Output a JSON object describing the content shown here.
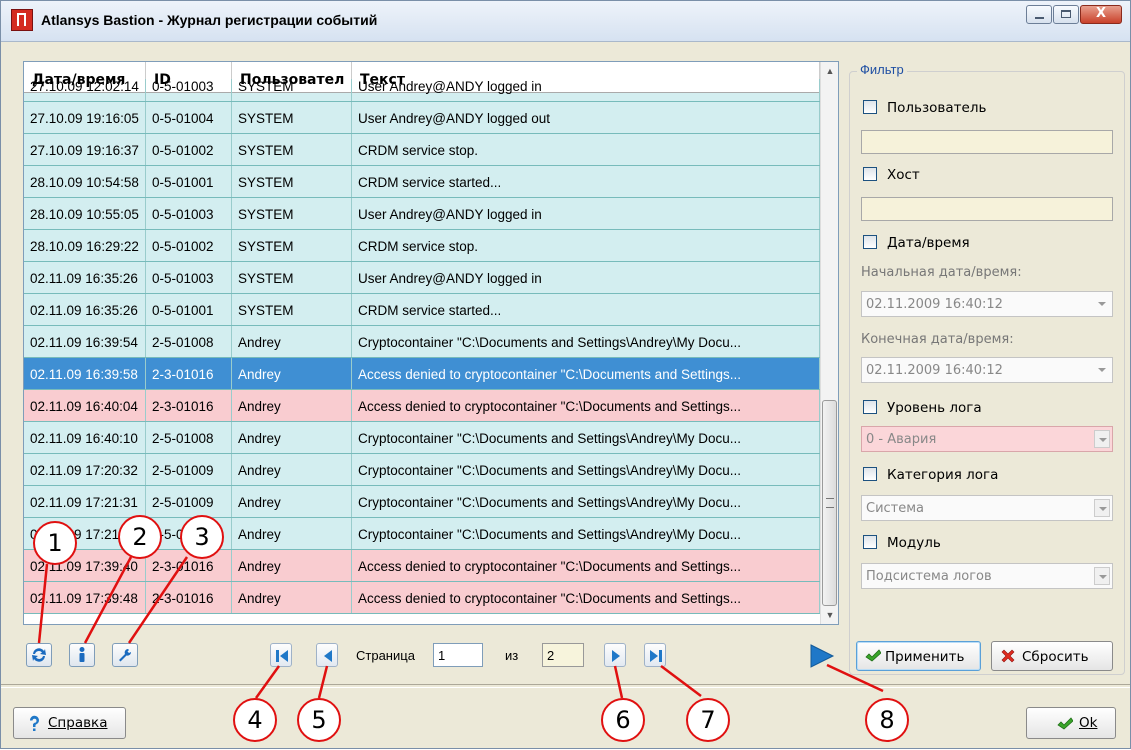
{
  "window": {
    "title": "Atlansys Bastion - Журнал регистрации событий",
    "close_glyph": "X"
  },
  "grid": {
    "columns": [
      "Дата/время",
      "ID",
      "Пользовател",
      "Текст"
    ],
    "partial_row": [
      "27.10.09 12:02:14",
      "0-5-01003",
      "SYSTEM",
      "User Andrey@ANDY logged in"
    ],
    "rows": [
      {
        "c": [
          "27.10.09 19:16:05",
          "0-5-01004",
          "SYSTEM",
          "User Andrey@ANDY logged out"
        ],
        "style": "cyan"
      },
      {
        "c": [
          "27.10.09 19:16:37",
          "0-5-01002",
          "SYSTEM",
          "CRDM service stop."
        ],
        "style": "cyan"
      },
      {
        "c": [
          "28.10.09 10:54:58",
          "0-5-01001",
          "SYSTEM",
          "CRDM service started..."
        ],
        "style": "cyan"
      },
      {
        "c": [
          "28.10.09 10:55:05",
          "0-5-01003",
          "SYSTEM",
          "User Andrey@ANDY logged in"
        ],
        "style": "cyan"
      },
      {
        "c": [
          "28.10.09 16:29:22",
          "0-5-01002",
          "SYSTEM",
          "CRDM service stop."
        ],
        "style": "cyan"
      },
      {
        "c": [
          "02.11.09 16:35:26",
          "0-5-01003",
          "SYSTEM",
          "User Andrey@ANDY logged in"
        ],
        "style": "cyan"
      },
      {
        "c": [
          "02.11.09 16:35:26",
          "0-5-01001",
          "SYSTEM",
          "CRDM service started..."
        ],
        "style": "cyan"
      },
      {
        "c": [
          "02.11.09 16:39:54",
          "2-5-01008",
          "Andrey",
          "Cryptocontainer \"C:\\Documents and Settings\\Andrey\\My Docu..."
        ],
        "style": "cyan"
      },
      {
        "c": [
          "02.11.09 16:39:58",
          "2-3-01016",
          "Andrey",
          "Access denied to cryptocontainer \"C:\\Documents and Settings..."
        ],
        "style": "sel"
      },
      {
        "c": [
          "02.11.09 16:40:04",
          "2-3-01016",
          "Andrey",
          "Access denied to cryptocontainer \"C:\\Documents and Settings..."
        ],
        "style": "pink"
      },
      {
        "c": [
          "02.11.09 16:40:10",
          "2-5-01008",
          "Andrey",
          "Cryptocontainer \"C:\\Documents and Settings\\Andrey\\My Docu..."
        ],
        "style": "cyan"
      },
      {
        "c": [
          "02.11.09 17:20:32",
          "2-5-01009",
          "Andrey",
          "Cryptocontainer \"C:\\Documents and Settings\\Andrey\\My Docu..."
        ],
        "style": "cyan"
      },
      {
        "c": [
          "02.11.09 17:21:31",
          "2-5-01009",
          "Andrey",
          "Cryptocontainer \"C:\\Documents and Settings\\Andrey\\My Docu..."
        ],
        "style": "cyan"
      },
      {
        "c": [
          "02.11.09 17:21:38",
          "2-5-01008",
          "Andrey",
          "Cryptocontainer \"C:\\Documents and Settings\\Andrey\\My Docu..."
        ],
        "style": "cyan"
      },
      {
        "c": [
          "02.11.09 17:39:40",
          "2-3-01016",
          "Andrey",
          "Access denied to cryptocontainer \"C:\\Documents and Settings..."
        ],
        "style": "pink"
      },
      {
        "c": [
          "02.11.09 17:39:48",
          "2-3-01016",
          "Andrey",
          "Access denied to cryptocontainer \"C:\\Documents and Settings..."
        ],
        "style": "pink"
      }
    ]
  },
  "toolbar": {
    "refresh_icon": "refresh-icon",
    "info_icon": "info-icon",
    "settings_icon": "wrench-icon"
  },
  "pager": {
    "page_label": "Страница",
    "page_value": "1",
    "of_label": "из",
    "total_pages": "2"
  },
  "filter": {
    "legend": "Фильтр",
    "user_label": "Пользователь",
    "user_value": "",
    "host_label": "Хост",
    "host_value": "",
    "datetime_label": "Дата/время",
    "start_label": "Начальная дата/время:",
    "start_value": "02.11.2009 16:40:12",
    "end_label": "Конечная дата/время:",
    "end_value": "02.11.2009 16:40:12",
    "level_label": "Уровень лога",
    "level_value": "0 - Авария",
    "category_label": "Категория лога",
    "category_value": "Система",
    "module_label": "Модуль",
    "module_value": "Подсистема логов",
    "apply_label": "Применить",
    "reset_label": "Сбросить"
  },
  "footer": {
    "help_label": "Справка",
    "ok_label": "Ok"
  },
  "callouts": [
    "1",
    "2",
    "3",
    "4",
    "5",
    "6",
    "7",
    "8"
  ],
  "colors": {
    "row_normal": "#d3eef0",
    "row_alert": "#f9ccd0",
    "row_selected": "#3f8fd3",
    "callout_ring": "#e01010"
  }
}
